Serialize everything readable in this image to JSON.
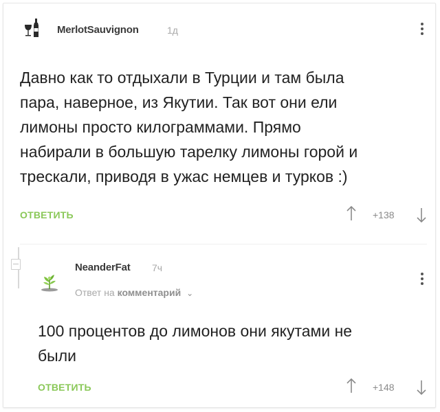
{
  "comments": [
    {
      "username": "MerlotSauvignon",
      "time": "1д",
      "avatar_icon": "wine-bottle-glass-icon",
      "text": "Давно как то отдыхали в Турции и там была\nпара, наверное, из Якутии. Так вот они ели\nлимоны просто килограммами. Прямо\nнабирали в большую тарелку лимоны горой и\nтрескали, приводя в ужас немцев и турков :)",
      "reply_label": "ОТВЕТИТЬ",
      "rating": "+138"
    },
    {
      "username": "NeanderFat",
      "time": "7ч",
      "avatar_icon": "green-plant-icon",
      "reply_prefix": "Ответ на",
      "reply_target": "комментарий",
      "text": "100 процентов до лимонов они якутами не\nбыли",
      "reply_label": "ОТВЕТИТЬ",
      "rating": "+148"
    }
  ],
  "colors": {
    "accent_green": "#8ac858",
    "meta_gray": "#a8a8a8"
  }
}
